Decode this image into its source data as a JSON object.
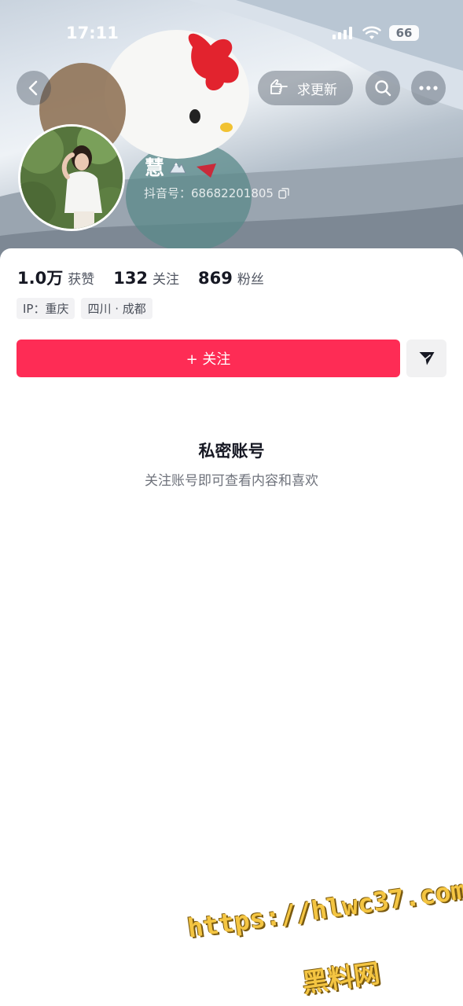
{
  "status_bar": {
    "time": "17:11",
    "battery": "66"
  },
  "header": {
    "request_update_label": "求更新",
    "display_name": "慧",
    "douyin_id": "抖音号：68682201805"
  },
  "stats": [
    {
      "value": "1.0万",
      "label": "获赞"
    },
    {
      "value": "132",
      "label": "关注"
    },
    {
      "value": "869",
      "label": "粉丝"
    }
  ],
  "tags": [
    "IP：重庆",
    "四川 · 成都"
  ],
  "actions": {
    "follow_label": "+ 关注"
  },
  "private": {
    "title": "私密账号",
    "subtitle": "关注账号即可查看内容和喜欢"
  },
  "watermark": {
    "line1": "https://hlwc37.com",
    "line2": "黑料网"
  },
  "colors": {
    "accent": "#fe2c55",
    "secondary_button": "#f1f1f2"
  },
  "icons": [
    "back-icon",
    "pointing-hand-icon",
    "search-icon",
    "more-icon",
    "copy-icon",
    "share-icon",
    "wifi-icon",
    "signal-icon"
  ]
}
